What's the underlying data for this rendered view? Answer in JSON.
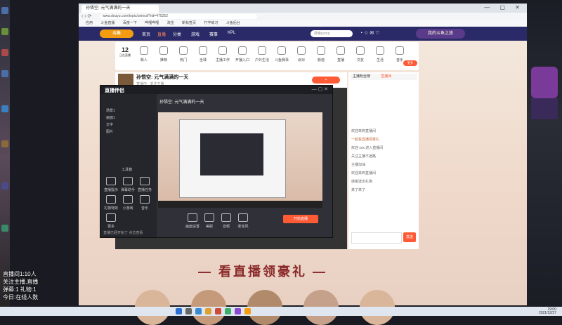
{
  "browser": {
    "tab_title": "孙悟空: 元气满满的一天",
    "url": "www.douyu.com/topic/uniwuli?rid=475252",
    "window_controls": "— ▢ ✕",
    "bookmarks": [
      "应用",
      "斗鱼直播",
      "百度一下",
      "哔哩哔哩",
      "淘宝",
      "新标签页",
      "打字练习",
      "斗鱼后台"
    ]
  },
  "site": {
    "logo": "斗鱼",
    "nav": [
      "首页",
      "直播",
      "分类",
      "游戏",
      "赛事",
      "KPL"
    ],
    "search_placeholder": "搜索pump",
    "promo": "我的斗鱼之旅"
  },
  "categories": {
    "count": "12",
    "count_label": "正在直播",
    "items": [
      "新人",
      "推荐",
      "热门",
      "全球",
      "主播工作",
      "开播入口",
      "户外生活",
      "斗鱼赛事",
      "派对",
      "颜值",
      "直播",
      "交友",
      "生活",
      "音乐",
      "更多"
    ]
  },
  "stream": {
    "title": "孙悟空: 元气满满的一天",
    "subtitle": "直播中 · 关注主播"
  },
  "chat": {
    "tabs": [
      "主播粉丝榜",
      "直播间"
    ],
    "messages": [
      "欢迎来到直播间",
      "一起看直播领豪礼",
      "欢迎 xxx 进入直播间",
      "关注主播不迷路",
      "主播加油",
      "欢迎来到直播间",
      "感谢送出礼物",
      "来了来了"
    ],
    "send_label": "发送"
  },
  "app": {
    "title": "直播伴侣",
    "scene_title": "孙悟空: 元气满满的一天",
    "side_items": [
      "场景1",
      "画面1",
      "文字",
      "图片"
    ],
    "tools_label": "工具箱",
    "tools": [
      "直播提示",
      "弹幕助手",
      "直播任务",
      "礼物特效",
      "小游戏",
      "音乐",
      "更多"
    ],
    "bottom_tools": [
      "画面设置",
      "美颜",
      "音频",
      "麦克风",
      "开始直播"
    ],
    "status": "直播已经开始了 点击查看"
  },
  "banner": {
    "text": "— 看直播领豪礼 —"
  },
  "overlay_text": [
    "直播间1:10人",
    "关注主播,直播",
    "弹幕:1 礼物:1",
    "今日:在线人数"
  ],
  "taskbar": {
    "time": "19:00",
    "date": "2021/12/27"
  },
  "colors": {
    "nav_bg": "#2a2a68",
    "accent": "#ff5a36",
    "logo": "#f39c12"
  }
}
